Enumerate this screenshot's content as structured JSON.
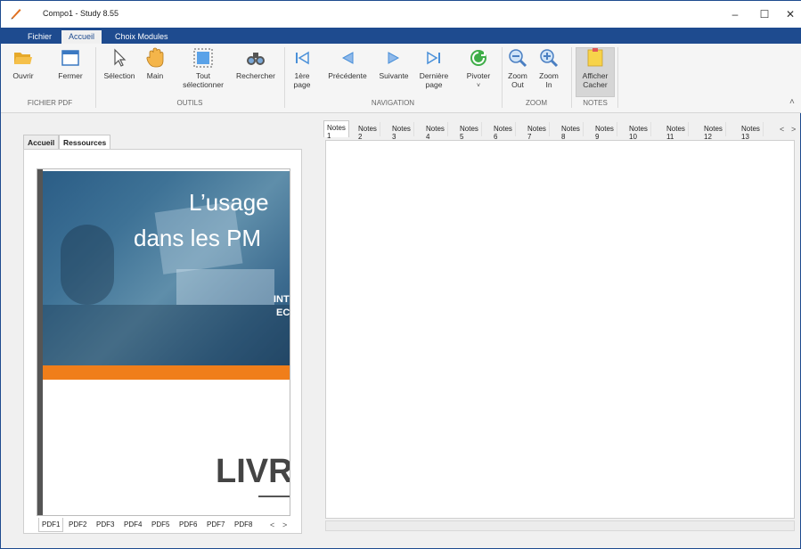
{
  "window": {
    "title": "Compo1 - Study 8.55",
    "controls": {
      "minimize": "–",
      "maximize": "☐",
      "close": "✕"
    }
  },
  "menu": {
    "tabs": [
      "Fichier",
      "Accueil",
      "Choix Modules"
    ],
    "active": "Accueil"
  },
  "ribbon": {
    "buttons": {
      "open": "Ouvrir",
      "close": "Fermer",
      "selection": "Sélection",
      "hand": "Main",
      "select_all_1": "Tout",
      "select_all_2": "sélectionner",
      "search": "Rechercher",
      "first_1": "1ère",
      "first_2": "page",
      "previous": "Précédente",
      "next": "Suivante",
      "last_1": "Dernière",
      "last_2": "page",
      "rotate": "Pivoter",
      "rotate_arrow": "˅",
      "zoom_out_1": "Zoom",
      "zoom_out_2": "Out",
      "zoom_in_1": "Zoom",
      "zoom_in_2": "In",
      "notes_1": "Afficher",
      "notes_2": "Cacher"
    },
    "groups": {
      "file": "FICHIER PDF",
      "tools": "OUTILS",
      "navigation": "NAVIGATION",
      "zoom": "ZOOM",
      "notes": "NOTES"
    },
    "collapse": "˄"
  },
  "left": {
    "tabs": [
      "Accueil",
      "Ressources PDF"
    ],
    "active": "Ressources PDF",
    "pdf_tabs": [
      "PDF1",
      "PDF2",
      "PDF3",
      "PDF4",
      "PDF5",
      "PDF6",
      "PDF7",
      "PDF8"
    ],
    "pdf_arrows": {
      "left": "<",
      "right": ">"
    },
    "document": {
      "heading_line1": "L’usage",
      "heading_line2": "dans les PM",
      "sub_line1": "INT",
      "sub_line2": "EC",
      "big_word": "LIVRI"
    }
  },
  "notes": {
    "tabs": [
      "Notes 1",
      "Notes 2",
      "Notes 3",
      "Notes 4",
      "Notes 5",
      "Notes 6",
      "Notes 7",
      "Notes 8",
      "Notes 9",
      "Notes 10",
      "Notes 11",
      "Notes 12",
      "Notes 13"
    ],
    "arrows": {
      "left": "<",
      "right": ">"
    }
  },
  "colors": {
    "titlebar_blue": "#1e4b8f",
    "accent_orange": "#f07e1a"
  }
}
